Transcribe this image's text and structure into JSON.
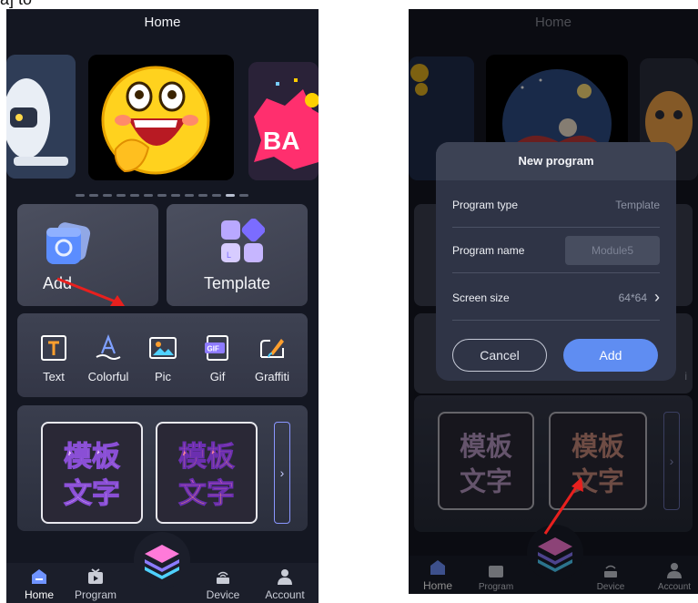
{
  "caption_fragment": "a] to",
  "left_screen": {
    "title": "Home",
    "add_label": "Add",
    "template_label": "Template",
    "tools": [
      {
        "label": "Text",
        "icon": "text-tool-icon"
      },
      {
        "label": "Colorful",
        "icon": "colorful-text-icon"
      },
      {
        "label": "Pic",
        "icon": "picture-icon"
      },
      {
        "label": "Gif",
        "icon": "gif-icon"
      },
      {
        "label": "Graffiti",
        "icon": "graffiti-icon"
      }
    ],
    "template_text_line1": "模板",
    "template_text_line2": "文字",
    "nav": {
      "home": "Home",
      "program": "Program",
      "device": "Device",
      "account": "Account"
    }
  },
  "right_screen": {
    "title": "Home",
    "dialog": {
      "title": "New program",
      "program_type_label": "Program type",
      "program_type_value": "Template",
      "program_name_label": "Program name",
      "program_name_placeholder": "Module5",
      "screen_size_label": "Screen size",
      "screen_size_value": "64*64",
      "cancel_label": "Cancel",
      "add_label": "Add"
    },
    "partial_tool_label": "i",
    "template_text_line1": "模板",
    "template_text_line2": "文字",
    "nav": {
      "home": "Home",
      "program": "Program",
      "device": "Device",
      "account": "Account"
    }
  },
  "colors": {
    "app_background": "#141722",
    "annotation_arrow": "#e8201e",
    "primary_button": "#5f8df2"
  }
}
